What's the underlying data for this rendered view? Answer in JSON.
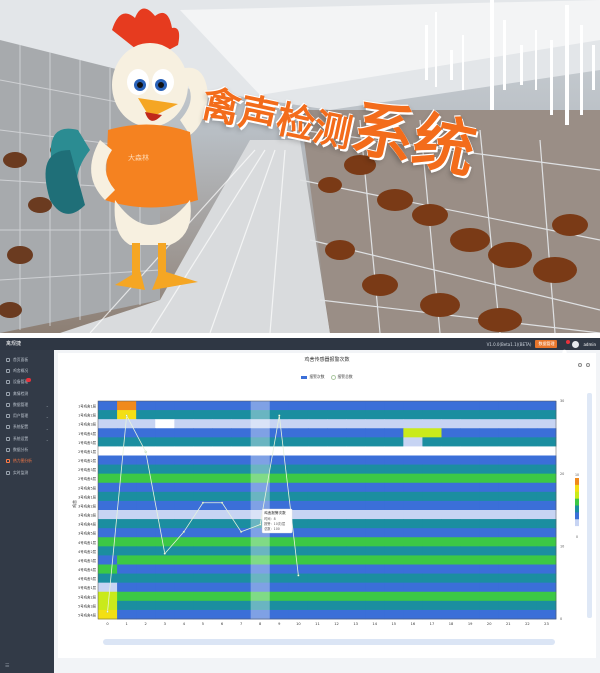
{
  "hero": {
    "title_line1": "禽声检测",
    "title_line2": "系统",
    "mascot_shirt_text": "Big Forest Chicken"
  },
  "app": {
    "brand": "禽规捷",
    "version": "V1.0.0(Beta1.1)(BETA)",
    "top_button": "数据管理",
    "user": "admin"
  },
  "sidebar": {
    "items": [
      {
        "label": "首页面板",
        "has_arrow": false
      },
      {
        "label": "鸡舍概况",
        "has_arrow": false
      },
      {
        "label": "设备管理",
        "has_arrow": false,
        "badge": true
      },
      {
        "label": "禽情检测",
        "has_arrow": false
      },
      {
        "label": "数据管理",
        "has_arrow": true
      },
      {
        "label": "用户管理",
        "has_arrow": true
      },
      {
        "label": "系统配置",
        "has_arrow": true
      },
      {
        "label": "系统设置",
        "has_arrow": true
      },
      {
        "label": "数据分析",
        "has_arrow": false
      },
      {
        "label": "热力图分析",
        "has_arrow": false,
        "active": true
      },
      {
        "label": "实时监测",
        "has_arrow": false
      }
    ],
    "footer_icon": "collapse-icon"
  },
  "chart_data": {
    "type": "heatmap",
    "title": "鸡舍传感器报警次数",
    "legend": [
      "报警次数",
      "报警总数"
    ],
    "ylabel": "鸡舍",
    "x": [
      "0",
      "1",
      "2",
      "3",
      "4",
      "5",
      "6",
      "7",
      "8",
      "9",
      "10",
      "11",
      "12",
      "13",
      "14",
      "15",
      "16",
      "17",
      "18",
      "19",
      "20",
      "21",
      "22",
      "23"
    ],
    "rows": [
      "1号鸡舍1层",
      "1号鸡舍2层",
      "1号鸡舍3层",
      "1号鸡舍4层",
      "1号鸡舍5层",
      "2号鸡舍1层",
      "2号鸡舍2层",
      "2号鸡舍3层",
      "2号鸡舍4层",
      "2号鸡舍5层",
      "3号鸡舍1层",
      "3号鸡舍2层",
      "3号鸡舍3层",
      "3号鸡舍4层",
      "3号鸡舍5层",
      "4号鸡舍1层",
      "4号鸡舍2层",
      "4号鸡舍3层",
      "4号鸡舍4层",
      "4号鸡舍5层",
      "5号鸡舍1层",
      "5号鸡舍2层",
      "5号鸡舍3层",
      "5号鸡舍4层"
    ],
    "visual_map": {
      "min": 0,
      "max": 10,
      "colors": [
        "#ffffff",
        "#c7d4f3",
        "#3b6fd8",
        "#1b8ea0",
        "#3cc845",
        "#c9ea1b",
        "#f3df14",
        "#f08a1d"
      ]
    },
    "line_series": {
      "name": "报警总数",
      "values": [
        1,
        28,
        23,
        9,
        12,
        16,
        16,
        12,
        13,
        28,
        6,
        null,
        null,
        null,
        null,
        null,
        null,
        null,
        null,
        null,
        null,
        null,
        null,
        null
      ],
      "ylim": [
        0,
        30
      ]
    },
    "tooltip": {
      "title": "鸡舍报警次数",
      "lines": [
        "时间：8",
        "报警：10次/层",
        "总数：100"
      ]
    }
  }
}
